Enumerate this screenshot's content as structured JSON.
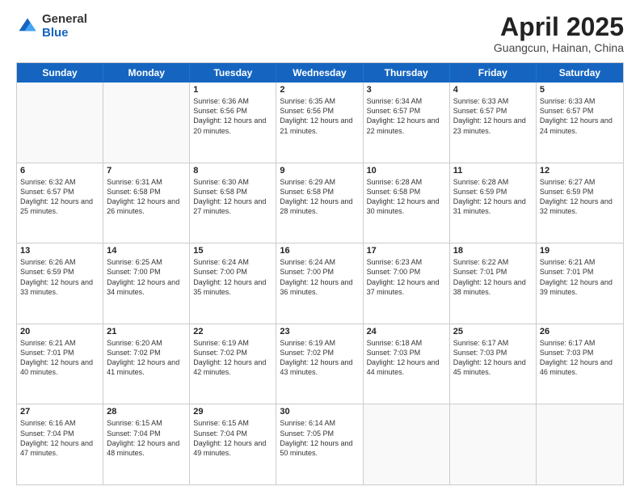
{
  "header": {
    "logo_general": "General",
    "logo_blue": "Blue",
    "month_title": "April 2025",
    "location": "Guangcun, Hainan, China"
  },
  "days_of_week": [
    "Sunday",
    "Monday",
    "Tuesday",
    "Wednesday",
    "Thursday",
    "Friday",
    "Saturday"
  ],
  "weeks": [
    [
      {
        "day": "",
        "sunrise": "",
        "sunset": "",
        "daylight": ""
      },
      {
        "day": "",
        "sunrise": "",
        "sunset": "",
        "daylight": ""
      },
      {
        "day": "1",
        "sunrise": "Sunrise: 6:36 AM",
        "sunset": "Sunset: 6:56 PM",
        "daylight": "Daylight: 12 hours and 20 minutes."
      },
      {
        "day": "2",
        "sunrise": "Sunrise: 6:35 AM",
        "sunset": "Sunset: 6:56 PM",
        "daylight": "Daylight: 12 hours and 21 minutes."
      },
      {
        "day": "3",
        "sunrise": "Sunrise: 6:34 AM",
        "sunset": "Sunset: 6:57 PM",
        "daylight": "Daylight: 12 hours and 22 minutes."
      },
      {
        "day": "4",
        "sunrise": "Sunrise: 6:33 AM",
        "sunset": "Sunset: 6:57 PM",
        "daylight": "Daylight: 12 hours and 23 minutes."
      },
      {
        "day": "5",
        "sunrise": "Sunrise: 6:33 AM",
        "sunset": "Sunset: 6:57 PM",
        "daylight": "Daylight: 12 hours and 24 minutes."
      }
    ],
    [
      {
        "day": "6",
        "sunrise": "Sunrise: 6:32 AM",
        "sunset": "Sunset: 6:57 PM",
        "daylight": "Daylight: 12 hours and 25 minutes."
      },
      {
        "day": "7",
        "sunrise": "Sunrise: 6:31 AM",
        "sunset": "Sunset: 6:58 PM",
        "daylight": "Daylight: 12 hours and 26 minutes."
      },
      {
        "day": "8",
        "sunrise": "Sunrise: 6:30 AM",
        "sunset": "Sunset: 6:58 PM",
        "daylight": "Daylight: 12 hours and 27 minutes."
      },
      {
        "day": "9",
        "sunrise": "Sunrise: 6:29 AM",
        "sunset": "Sunset: 6:58 PM",
        "daylight": "Daylight: 12 hours and 28 minutes."
      },
      {
        "day": "10",
        "sunrise": "Sunrise: 6:28 AM",
        "sunset": "Sunset: 6:58 PM",
        "daylight": "Daylight: 12 hours and 30 minutes."
      },
      {
        "day": "11",
        "sunrise": "Sunrise: 6:28 AM",
        "sunset": "Sunset: 6:59 PM",
        "daylight": "Daylight: 12 hours and 31 minutes."
      },
      {
        "day": "12",
        "sunrise": "Sunrise: 6:27 AM",
        "sunset": "Sunset: 6:59 PM",
        "daylight": "Daylight: 12 hours and 32 minutes."
      }
    ],
    [
      {
        "day": "13",
        "sunrise": "Sunrise: 6:26 AM",
        "sunset": "Sunset: 6:59 PM",
        "daylight": "Daylight: 12 hours and 33 minutes."
      },
      {
        "day": "14",
        "sunrise": "Sunrise: 6:25 AM",
        "sunset": "Sunset: 7:00 PM",
        "daylight": "Daylight: 12 hours and 34 minutes."
      },
      {
        "day": "15",
        "sunrise": "Sunrise: 6:24 AM",
        "sunset": "Sunset: 7:00 PM",
        "daylight": "Daylight: 12 hours and 35 minutes."
      },
      {
        "day": "16",
        "sunrise": "Sunrise: 6:24 AM",
        "sunset": "Sunset: 7:00 PM",
        "daylight": "Daylight: 12 hours and 36 minutes."
      },
      {
        "day": "17",
        "sunrise": "Sunrise: 6:23 AM",
        "sunset": "Sunset: 7:00 PM",
        "daylight": "Daylight: 12 hours and 37 minutes."
      },
      {
        "day": "18",
        "sunrise": "Sunrise: 6:22 AM",
        "sunset": "Sunset: 7:01 PM",
        "daylight": "Daylight: 12 hours and 38 minutes."
      },
      {
        "day": "19",
        "sunrise": "Sunrise: 6:21 AM",
        "sunset": "Sunset: 7:01 PM",
        "daylight": "Daylight: 12 hours and 39 minutes."
      }
    ],
    [
      {
        "day": "20",
        "sunrise": "Sunrise: 6:21 AM",
        "sunset": "Sunset: 7:01 PM",
        "daylight": "Daylight: 12 hours and 40 minutes."
      },
      {
        "day": "21",
        "sunrise": "Sunrise: 6:20 AM",
        "sunset": "Sunset: 7:02 PM",
        "daylight": "Daylight: 12 hours and 41 minutes."
      },
      {
        "day": "22",
        "sunrise": "Sunrise: 6:19 AM",
        "sunset": "Sunset: 7:02 PM",
        "daylight": "Daylight: 12 hours and 42 minutes."
      },
      {
        "day": "23",
        "sunrise": "Sunrise: 6:19 AM",
        "sunset": "Sunset: 7:02 PM",
        "daylight": "Daylight: 12 hours and 43 minutes."
      },
      {
        "day": "24",
        "sunrise": "Sunrise: 6:18 AM",
        "sunset": "Sunset: 7:03 PM",
        "daylight": "Daylight: 12 hours and 44 minutes."
      },
      {
        "day": "25",
        "sunrise": "Sunrise: 6:17 AM",
        "sunset": "Sunset: 7:03 PM",
        "daylight": "Daylight: 12 hours and 45 minutes."
      },
      {
        "day": "26",
        "sunrise": "Sunrise: 6:17 AM",
        "sunset": "Sunset: 7:03 PM",
        "daylight": "Daylight: 12 hours and 46 minutes."
      }
    ],
    [
      {
        "day": "27",
        "sunrise": "Sunrise: 6:16 AM",
        "sunset": "Sunset: 7:04 PM",
        "daylight": "Daylight: 12 hours and 47 minutes."
      },
      {
        "day": "28",
        "sunrise": "Sunrise: 6:15 AM",
        "sunset": "Sunset: 7:04 PM",
        "daylight": "Daylight: 12 hours and 48 minutes."
      },
      {
        "day": "29",
        "sunrise": "Sunrise: 6:15 AM",
        "sunset": "Sunset: 7:04 PM",
        "daylight": "Daylight: 12 hours and 49 minutes."
      },
      {
        "day": "30",
        "sunrise": "Sunrise: 6:14 AM",
        "sunset": "Sunset: 7:05 PM",
        "daylight": "Daylight: 12 hours and 50 minutes."
      },
      {
        "day": "",
        "sunrise": "",
        "sunset": "",
        "daylight": ""
      },
      {
        "day": "",
        "sunrise": "",
        "sunset": "",
        "daylight": ""
      },
      {
        "day": "",
        "sunrise": "",
        "sunset": "",
        "daylight": ""
      }
    ]
  ]
}
